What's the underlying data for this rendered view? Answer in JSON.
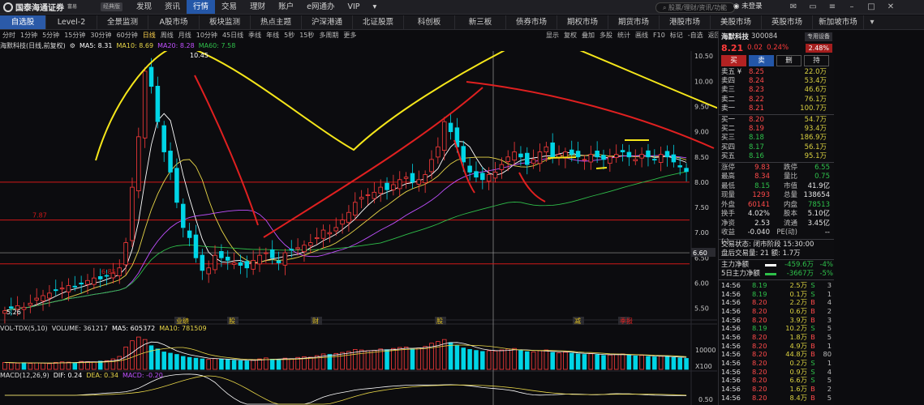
{
  "app": {
    "logo_text": "国泰海通证券",
    "logo_sub": "富易",
    "skin_label": "经典版",
    "menu": [
      "发现",
      "资讯",
      "行情",
      "交易",
      "理财",
      "账户",
      "e网通办",
      "VIP"
    ],
    "menu_active": 2,
    "search_placeholder": "股票/理财/资讯/功能",
    "login": "未登录",
    "menu_more": "▾"
  },
  "tabs": {
    "items": [
      "自选股",
      "Level-2",
      "全景监测",
      "A股市场",
      "板块监测",
      "热点主题",
      "沪深港通",
      "北证股票",
      "科创板",
      "新三板",
      "债券市场",
      "期权市场",
      "期货市场",
      "港股市场",
      "美股市场",
      "英股市场",
      "新加坡市场"
    ],
    "active": 0,
    "more": "▾"
  },
  "periods": {
    "items": [
      "分时",
      "1分钟",
      "5分钟",
      "15分钟",
      "30分钟",
      "60分钟",
      "日线",
      "周线",
      "月线",
      "10分钟",
      "45日线",
      "季线",
      "年线",
      "5秒",
      "15秒",
      "多周期",
      "更多"
    ],
    "active": 6,
    "right_options": [
      "显示",
      "复权",
      "叠加",
      "多股",
      "统计",
      "画线",
      "F10",
      "标记",
      "-自选",
      "返回"
    ]
  },
  "legend": {
    "title": "海默科技(日线,前复权)",
    "ma5": "MA5: 8.31",
    "ma10": "MA10: 8.69",
    "ma20": "MA20: 8.28",
    "ma60": "MA60: 7.58"
  },
  "colors": {
    "up": "#ff3b3b",
    "down": "#00d5e6",
    "ma5": "#ffffff",
    "ma10": "#e8d648",
    "ma20": "#c050ff",
    "ma60": "#2fbf4a",
    "annotation_red": "#e02020",
    "annotation_yellow": "#f5e61a"
  },
  "chart_data": {
    "type": "candlestick",
    "price_axis": [
      "10.50",
      "10.00",
      "9.50",
      "9.00",
      "8.50",
      "8.00",
      "7.50",
      "7.00",
      "6.50",
      "6.00",
      "5.50"
    ],
    "ylim": [
      5.3,
      10.6
    ],
    "high_label": "10.45",
    "low_label": "5.26",
    "crosshair_price": "6.60",
    "red_line_labels": [
      "7.87",
      "6.85"
    ],
    "event_markers": [
      "业绩",
      "股",
      "财",
      "股",
      "减",
      "季报"
    ],
    "volume_axis": [
      "10000",
      "X100"
    ],
    "macd_axis": [
      "0.50"
    ],
    "close": [
      5.45,
      5.5,
      5.55,
      5.52,
      5.6,
      5.7,
      5.75,
      5.8,
      5.85,
      5.9,
      5.95,
      5.92,
      5.98,
      6.05,
      6.1,
      6.08,
      6.15,
      6.2,
      6.3,
      6.8,
      7.9,
      8.9,
      10.2,
      9.9,
      9.2,
      8.6,
      8.2,
      7.6,
      7.1,
      6.9,
      6.5,
      6.25,
      6.3,
      6.55,
      6.5,
      6.45,
      6.4,
      6.35,
      6.3,
      6.45,
      6.55,
      6.6,
      6.5,
      6.4,
      6.6,
      6.65,
      6.7,
      6.75,
      6.8,
      6.9,
      7.05,
      7.0,
      7.1,
      7.25,
      7.4,
      7.6,
      7.7,
      7.75,
      7.8,
      7.9,
      7.85,
      7.95,
      8.05,
      8.1,
      8.0,
      8.05,
      8.15,
      8.45,
      8.7,
      9.2,
      9.0,
      8.7,
      8.4,
      8.2,
      8.1,
      8.05,
      8.15,
      8.2,
      8.35,
      8.5,
      8.6,
      8.5,
      8.35,
      8.45,
      8.6,
      8.7,
      8.5,
      8.55,
      8.6,
      8.55,
      8.5,
      8.45,
      8.55,
      8.5,
      8.45,
      8.5,
      8.55,
      8.6,
      8.5,
      8.45,
      8.55,
      8.5,
      8.45,
      8.55,
      8.5,
      8.4,
      8.3,
      8.21
    ],
    "volume_max": 14000,
    "volumes": [
      2800,
      2600,
      2500,
      2700,
      2400,
      2600,
      2500,
      2300,
      2800,
      3000,
      2900,
      2700,
      3200,
      3100,
      3000,
      3300,
      3500,
      4200,
      5200,
      9000,
      11500,
      13000,
      12000,
      9500,
      8200,
      7000,
      6500,
      6000,
      5200,
      4800,
      4500,
      4200,
      4000,
      4300,
      4100,
      3900,
      3600,
      3500,
      3400,
      3900,
      4200,
      4600,
      4100,
      3800,
      4500,
      4300,
      4800,
      5100,
      4900,
      5500,
      6200,
      6000,
      6400,
      6800,
      7200,
      8000,
      7800,
      7500,
      7600,
      8200,
      7900,
      8400,
      8800,
      9000,
      8200,
      8600,
      9200,
      10500,
      11200,
      12000,
      10800,
      9500,
      8600,
      8000,
      7600,
      7200,
      7500,
      7400,
      7800,
      8200,
      8400,
      7600,
      7100,
      7000,
      7500,
      7800,
      6800,
      6600,
      6900,
      6500,
      6200,
      6000,
      6300,
      5900,
      5600,
      5800,
      6000,
      6200,
      5700,
      5400,
      5600,
      5200,
      5000,
      5300,
      5100,
      4800,
      4600,
      4400
    ]
  },
  "vol_legend": {
    "title": "VOL-TDX(5,10)",
    "vol": "VOLUME: 361217",
    "ma5": "MA5: 605372",
    "ma10": "MA10: 781509"
  },
  "macd_legend": {
    "title": "MACD(12,26,9)",
    "dif": "DIF: 0.24",
    "dea": "DEA: 0.34",
    "macd": "MACD: -0.20"
  },
  "panel": {
    "name": "海默科技",
    "code": "300084",
    "tag": "专用设备",
    "price": "8.21",
    "change": "0.02",
    "change_pct": "0.24%",
    "badge": "2.48%",
    "buttons": [
      "买",
      "卖",
      "删",
      "持"
    ],
    "asks": [
      {
        "label": "卖五 ¥",
        "price": "8.25",
        "vol": "22.0万"
      },
      {
        "label": "卖四",
        "price": "8.24",
        "vol": "53.4万"
      },
      {
        "label": "卖三",
        "price": "8.23",
        "vol": "46.6万"
      },
      {
        "label": "卖二",
        "price": "8.22",
        "vol": "76.1万"
      },
      {
        "label": "卖一",
        "price": "8.21",
        "vol": "100.7万"
      }
    ],
    "bids": [
      {
        "label": "买一",
        "price": "8.20",
        "vol": "54.7万"
      },
      {
        "label": "买二",
        "price": "8.19",
        "vol": "93.4万"
      },
      {
        "label": "买三",
        "price": "8.18",
        "vol": "186.9万"
      },
      {
        "label": "买四",
        "price": "8.17",
        "vol": "56.1万"
      },
      {
        "label": "买五",
        "price": "8.16",
        "vol": "95.1万"
      }
    ],
    "stats": [
      {
        "k": "涨停",
        "v": "9.83",
        "vc": "red",
        "k2": "跌停",
        "v2": "6.55",
        "v2c": "grn"
      },
      {
        "k": "最高",
        "v": "8.34",
        "vc": "red",
        "k2": "量比",
        "v2": "0.75",
        "v2c": "grn"
      },
      {
        "k": "最低",
        "v": "8.15",
        "vc": "grn",
        "k2": "市值",
        "v2": "41.9亿",
        "v2c": "wht"
      },
      {
        "k": "现量",
        "v": "1293",
        "vc": "red",
        "k2": "总量",
        "v2": "138654",
        "v2c": "wht"
      },
      {
        "k": "外盘",
        "v": "60141",
        "vc": "red",
        "k2": "内盘",
        "v2": "78513",
        "v2c": "grn"
      },
      {
        "k": "换手",
        "v": "4.02%",
        "vc": "wht",
        "k2": "股本",
        "v2": "5.10亿",
        "v2c": "wht"
      },
      {
        "k": "净资",
        "v": "2.53",
        "vc": "wht",
        "k2": "流通",
        "v2": "3.45亿",
        "v2c": "wht"
      },
      {
        "k": "收益(-)",
        "v": "-0.040",
        "vc": "wht",
        "k2": "PE(动)",
        "v2": "--",
        "v2c": "wht"
      }
    ],
    "status_line": "交易状态: 闭市阶段 15:30:00",
    "after_line": "盘后交易量: 21  额: 1.7万",
    "flows": [
      {
        "k": "主力净额",
        "v": "-459.6万",
        "pct": "-4%",
        "color": "#ffffff"
      },
      {
        "k": "5日主力净额",
        "v": "-3667万",
        "pct": "-5%",
        "color": "#2ec04a"
      }
    ],
    "ticks": [
      {
        "t": "14:56",
        "p": "8.19",
        "pc": "grn",
        "v": "2.5万",
        "s": "S",
        "n": "3"
      },
      {
        "t": "14:56",
        "p": "8.19",
        "pc": "grn",
        "v": "0.1万",
        "s": "S",
        "n": "1"
      },
      {
        "t": "14:56",
        "p": "8.20",
        "pc": "red",
        "v": "2.2万",
        "s": "B",
        "n": "4"
      },
      {
        "t": "14:56",
        "p": "8.20",
        "pc": "red",
        "v": "0.6万",
        "s": "B",
        "n": "2"
      },
      {
        "t": "14:56",
        "p": "8.20",
        "pc": "red",
        "v": "3.9万",
        "s": "B",
        "n": "3"
      },
      {
        "t": "14:56",
        "p": "8.19",
        "pc": "grn",
        "v": "10.2万",
        "s": "S",
        "n": "5"
      },
      {
        "t": "14:56",
        "p": "8.20",
        "pc": "red",
        "v": "1.8万",
        "s": "B",
        "n": "5"
      },
      {
        "t": "14:56",
        "p": "8.20",
        "pc": "red",
        "v": "4.9万",
        "s": "B",
        "n": "1"
      },
      {
        "t": "14:56",
        "p": "8.20",
        "pc": "red",
        "v": "44.8万",
        "s": "B",
        "n": "80"
      },
      {
        "t": "14:56",
        "p": "8.20",
        "pc": "red",
        "v": "0.2万",
        "s": "S",
        "n": "1"
      },
      {
        "t": "14:56",
        "p": "8.20",
        "pc": "red",
        "v": "0.9万",
        "s": "S",
        "n": "4"
      },
      {
        "t": "14:56",
        "p": "8.20",
        "pc": "red",
        "v": "6.6万",
        "s": "S",
        "n": "5"
      },
      {
        "t": "14:56",
        "p": "8.20",
        "pc": "red",
        "v": "1.6万",
        "s": "B",
        "n": "2"
      },
      {
        "t": "14:56",
        "p": "8.20",
        "pc": "red",
        "v": "8.4万",
        "s": "B",
        "n": "5"
      }
    ]
  }
}
